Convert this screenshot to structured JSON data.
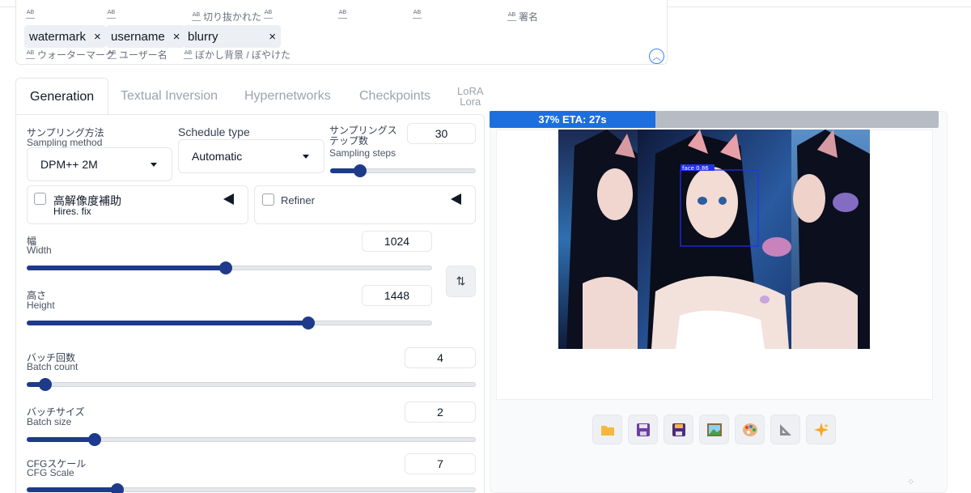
{
  "negative_tokens": {
    "top_row_labels": [
      "",
      "",
      "切り抜かれた",
      "",
      "",
      "",
      "署名"
    ],
    "chips": [
      {
        "text": "watermark",
        "sub": "ウォーターマーク"
      },
      {
        "text": "username",
        "sub": "ユーザー名"
      },
      {
        "text": "blurry",
        "sub": "ぼかし背景 / ぼやけた"
      }
    ],
    "remove_symbol": "×",
    "collapse_symbol": "︿"
  },
  "tabs": {
    "generation": "Generation",
    "textual_inversion": "Textual Inversion",
    "hypernetworks": "Hypernetworks",
    "checkpoints": "Checkpoints",
    "lora_top": "LoRA",
    "lora_bottom": "Lora"
  },
  "sampling": {
    "method_jp": "サンプリング方法",
    "method_en": "Sampling method",
    "method_value": "DPM++ 2M",
    "schedule_label": "Schedule type",
    "schedule_value": "Automatic",
    "steps_jp": "サンプリングステップ数",
    "steps_en": "Sampling steps",
    "steps_value": "30",
    "steps_fraction": 0.2
  },
  "hires": {
    "jp": "高解像度補助",
    "en": "Hires. fix"
  },
  "refiner": {
    "label": "Refiner"
  },
  "width": {
    "jp": "幅",
    "en": "Width",
    "value": "1024",
    "fraction": 0.49
  },
  "height": {
    "jp": "高さ",
    "en": "Height",
    "value": "1448",
    "fraction": 0.695
  },
  "swap_symbol": "⇅",
  "batch_count": {
    "jp": "バッチ回数",
    "en": "Batch count",
    "value": "4",
    "fraction": 0.04
  },
  "batch_size": {
    "jp": "バッチサイズ",
    "en": "Batch size",
    "value": "2",
    "fraction": 0.15
  },
  "cfg": {
    "jp": "CFGスケール",
    "en": "CFG Scale",
    "value": "7",
    "fraction": 0.2
  },
  "progress": {
    "text": "37% ETA: 27s",
    "fraction": 0.37
  },
  "preview": {
    "detection_label": "face  0.86"
  },
  "toolbar_icons": [
    "folder-icon",
    "save-icon",
    "zip-icon",
    "image-icon",
    "palette-icon",
    "ruler-icon",
    "sparkle-icon"
  ],
  "colors": {
    "accent": "#1e3a8a",
    "progress": "#1d6fe0",
    "detection": "#2233ee"
  }
}
